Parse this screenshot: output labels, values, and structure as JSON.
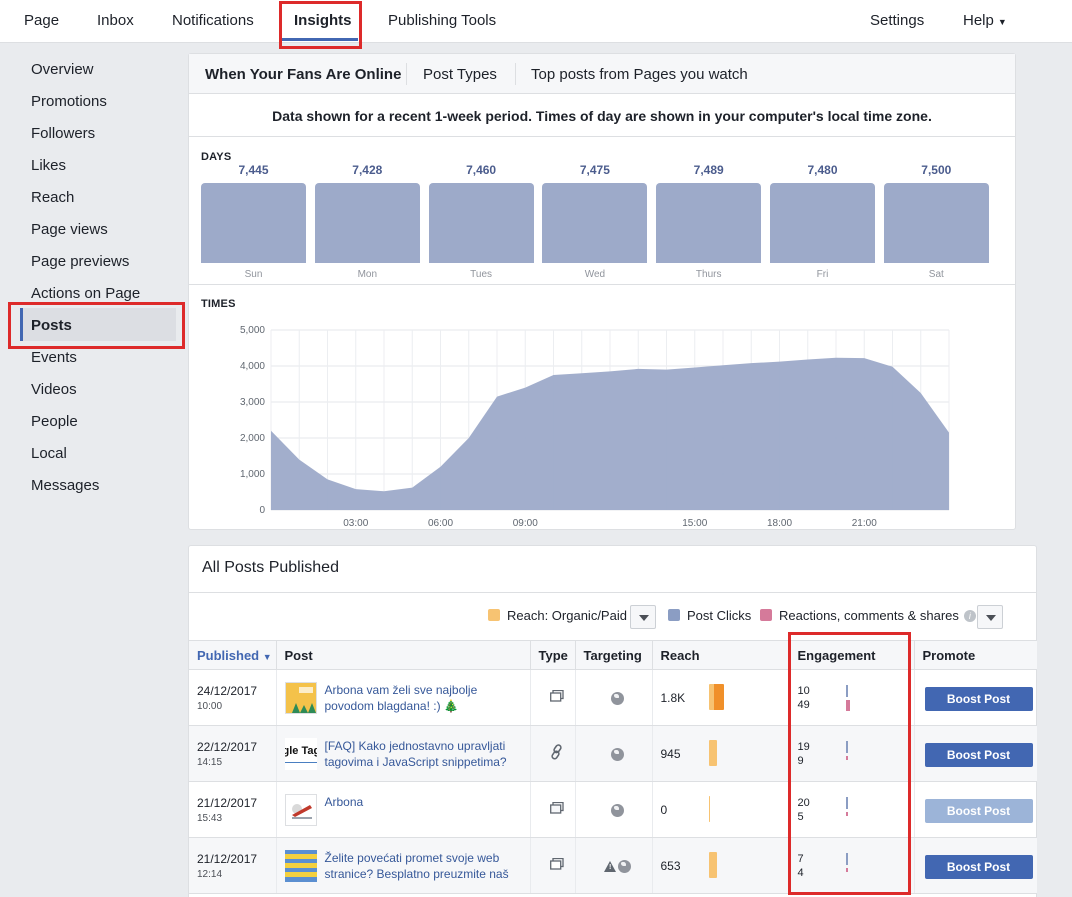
{
  "topnav": {
    "items": [
      {
        "label": "Page"
      },
      {
        "label": "Inbox"
      },
      {
        "label": "Notifications"
      },
      {
        "label": "Insights"
      },
      {
        "label": "Publishing Tools"
      }
    ],
    "settings": "Settings",
    "help": "Help"
  },
  "sidebar": {
    "items": [
      {
        "label": "Overview"
      },
      {
        "label": "Promotions"
      },
      {
        "label": "Followers"
      },
      {
        "label": "Likes"
      },
      {
        "label": "Reach"
      },
      {
        "label": "Page views"
      },
      {
        "label": "Page previews"
      },
      {
        "label": "Actions on Page"
      },
      {
        "label": "Posts"
      },
      {
        "label": "Events"
      },
      {
        "label": "Videos"
      },
      {
        "label": "People"
      },
      {
        "label": "Local"
      },
      {
        "label": "Messages"
      }
    ],
    "active": "Posts"
  },
  "online": {
    "tabs": [
      {
        "label": "When Your Fans Are Online"
      },
      {
        "label": "Post Types"
      },
      {
        "label": "Top posts from Pages you watch"
      }
    ],
    "notice": "Data shown for a recent 1-week period. Times of day are shown in your computer's local time zone.",
    "days_label": "DAYS",
    "times_label": "TIMES"
  },
  "chart_data": [
    {
      "type": "bar",
      "categories": [
        "Sun",
        "Mon",
        "Tues",
        "Wed",
        "Thurs",
        "Fri",
        "Sat"
      ],
      "values": [
        7445,
        7428,
        7460,
        7475,
        7489,
        7480,
        7500
      ],
      "value_labels": [
        "7,445",
        "7,428",
        "7,460",
        "7,475",
        "7,489",
        "7,480",
        "7,500"
      ]
    },
    {
      "type": "area",
      "x_hours": [
        0,
        1,
        2,
        3,
        4,
        5,
        6,
        7,
        8,
        9,
        10,
        11,
        12,
        13,
        14,
        15,
        16,
        17,
        18,
        19,
        20,
        21,
        22,
        23
      ],
      "values": [
        2200,
        1400,
        850,
        580,
        520,
        620,
        1200,
        2000,
        3150,
        3400,
        3750,
        3800,
        3850,
        3920,
        3900,
        3960,
        4020,
        4080,
        4120,
        4180,
        4230,
        4220,
        3980,
        3250,
        2150
      ],
      "y_ticks": [
        "0",
        "1,000",
        "2,000",
        "3,000",
        "4,000",
        "5,000"
      ],
      "x_ticks": [
        "03:00",
        "06:00",
        "09:00",
        "15:00",
        "18:00",
        "21:00"
      ],
      "ylim": [
        0,
        5000
      ],
      "grid": true,
      "color": "#9daac9"
    }
  ],
  "posts": {
    "title": "All Posts Published",
    "legend": [
      {
        "label": "Reach: Organic/Paid",
        "color": "#f7c372"
      },
      {
        "label": "Post Clicks",
        "color": "#8b9dc3"
      },
      {
        "label": "Reactions, comments & shares",
        "color": "#d57a9a"
      }
    ],
    "columns": {
      "published": "Published",
      "post": "Post",
      "type": "Type",
      "targeting": "Targeting",
      "reach": "Reach",
      "engagement": "Engagement",
      "promote": "Promote"
    },
    "rows": [
      {
        "date": "24/12/2017",
        "time": "10:00",
        "text": "Arbona vam želi sve najbolje povodom blagdana! :) 🎄",
        "reach": "1.8K",
        "reach_share": 0.92,
        "clicks": "10",
        "reactions": "49",
        "reactions_share": 0.9,
        "boost": "Boost Post"
      },
      {
        "date": "22/12/2017",
        "time": "14:15",
        "text": "[FAQ] Kako jednostavno upravljati tagovima i JavaScript snippetima?",
        "reach": "945",
        "reach_share": 0.48,
        "clicks": "19",
        "reactions": "9",
        "reactions_share": 0.35,
        "boost": "Boost Post",
        "thumb_text": "gle Tag"
      },
      {
        "date": "21/12/2017",
        "time": "15:43",
        "text": "Arbona",
        "reach": "0",
        "reach_share": 0.0,
        "clicks": "20",
        "reactions": "5",
        "reactions_share": 0.3,
        "boost": "Boost Post"
      },
      {
        "date": "21/12/2017",
        "time": "12:14",
        "text": "Želite povećati promet svoje web stranice? Besplatno preuzmite naš",
        "reach": "653",
        "reach_share": 0.36,
        "clicks": "7",
        "reactions": "4",
        "reactions_share": 0.25,
        "boost": "Boost Post"
      }
    ]
  }
}
